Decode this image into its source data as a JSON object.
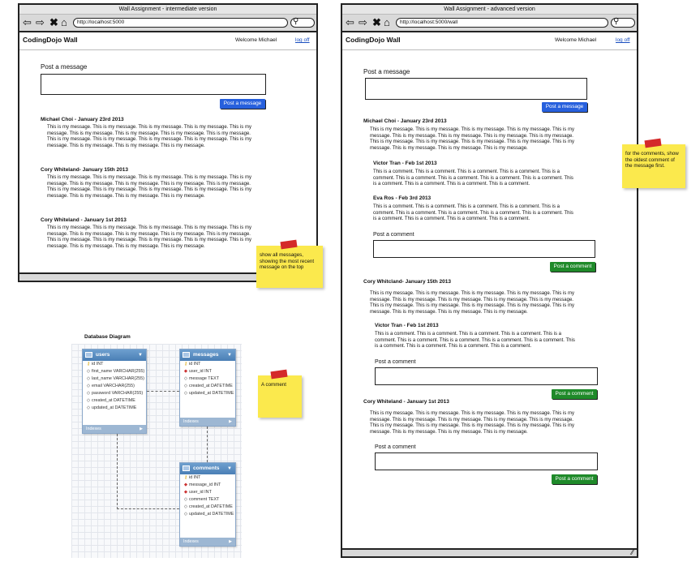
{
  "left_window": {
    "title": "Wall Assignment - intermediate version",
    "url": "http://localhost:5000",
    "brand": "CodingDojo Wall",
    "welcome": "Welcome Michael",
    "logoff": "log off",
    "post_label": "Post a message",
    "post_button": "Post a message",
    "messages": [
      {
        "author": "Michael Choi - January 23rd 2013",
        "lines": [
          "This is my message. This is my message. This is my message. This is my message. This is my",
          "message. This is my message. This is my message. This is my message. This is my message.",
          "This is my message. This is my message. This is my message. This is my message. This is my",
          "message. This is my message. This is my message. This is my message."
        ]
      },
      {
        "author": "Cory Whiteland- January 15th 2013",
        "lines": [
          "This is my message. This is my message. This is my message. This is my message. This is my",
          "message. This is my message. This is my message. This is my message. This is my message.",
          "This is my message. This is my message. This is my message. This is my message. This is my",
          "message. This is my message. This is my message. This is my message."
        ]
      },
      {
        "author": "Cory Whiteland - January 1st 2013",
        "lines": [
          "This is my message. This is my message. This is my message. This is my message. This is my",
          "message. This is my message. This is my message. This is my message. This is my message.",
          "This is my message. This is my message. This is my message. This is my message. This is my",
          "message. This is my message. This is my message. This is my message."
        ]
      }
    ],
    "sticky": "show all messages, showing the most recent message on the top"
  },
  "right_window": {
    "title": "Wall Assignment - advanced version",
    "url": "http://localhost:5000/wall",
    "brand": "CodingDojo Wall",
    "welcome": "Welcome Michael",
    "logoff": "log off",
    "post_label": "Post a message",
    "post_button": "Post a message",
    "comment_label": "Post a comment",
    "comment_button": "Post a comment",
    "messages": [
      {
        "author": "Michael Choi - January 23rd 2013",
        "lines": [
          "This is my message. This is my message. This is my message. This is my message. This is my",
          "message. This is my message. This is my message. This is my message. This is my message.",
          "This is my message. This is my message. This is my message. This is my message. This is my",
          "message. This is my message. This is my message. This is my message."
        ],
        "comments": [
          {
            "author": "Victor Tran - Feb 1st 2013",
            "lines": [
              "This is a comment. This is a comment. This is a comment. This is a comment. This is a",
              "comment. This is a comment. This is a comment. This is a comment. This is a comment. This",
              "is a comment. This is a comment. This is a comment. This is a comment."
            ]
          },
          {
            "author": "Eva Ros - Feb 3rd 2013",
            "lines": [
              "This is a comment. This is a comment. This is a comment. This is a comment. This is a",
              "comment. This is a comment. This is a comment. This is a comment. This is a comment. This",
              "is a comment. This is a comment. This is a comment. This is a comment."
            ]
          }
        ]
      },
      {
        "author": "Cory Whitcland- January 15th 2013",
        "lines": [
          "This is my message. This is my message. This is my message. This is my message. This is my",
          "message. This is my message. This is my message. This is my message. This is my message.",
          "This is my message. This is my message. This is my message. This is my message. This is my",
          "message. This is my message. This is my message. This is my message."
        ],
        "comments": [
          {
            "author": "Victor Tran - Feb 1st 2013",
            "lines": [
              "This is a comment. This is a comment. This is a comment. This is a comment. This is a",
              "comment. This is a comment. This is a comment. This is a comment. This is a comment. This",
              "is a comment. This is a comment. This is a comment. This is a comment."
            ]
          }
        ]
      },
      {
        "author": "Cory Whiteland - January 1st 2013",
        "lines": [
          "This is my message. This is my message. This is my message. This is my message. This is my",
          "message. This is my message. This is my message. This is my message. This is my message.",
          "This is my message. This is my message. This is my message. This is my message. This is my",
          "message. This is my message. This is my message. This is my message."
        ],
        "comments": []
      }
    ],
    "sticky": "for the comments, show the oldest comment of the message first."
  },
  "diagram": {
    "title": "Database Diagram",
    "sticky": "A comment",
    "tables": [
      {
        "name": "users",
        "columns": [
          "id INT",
          "first_name VARCHAR(255)",
          "last_name VARCHAR(255)",
          "email VARCHAR(255)",
          "password VARCHAR(255)",
          "created_at DATETIME",
          "updated_at DATETIME"
        ],
        "footer": "Indexes"
      },
      {
        "name": "messages",
        "columns": [
          "id INT",
          "user_id INT",
          "message TEXT",
          "created_at DATETIME",
          "updated_at DATETIME"
        ],
        "footer": "Indexes"
      },
      {
        "name": "comments",
        "columns": [
          "id INT",
          "message_id INT",
          "user_id INT",
          "comment TEXT",
          "created_at DATETIME",
          "updated_at DATETIME"
        ],
        "footer": "Indexes"
      }
    ]
  }
}
